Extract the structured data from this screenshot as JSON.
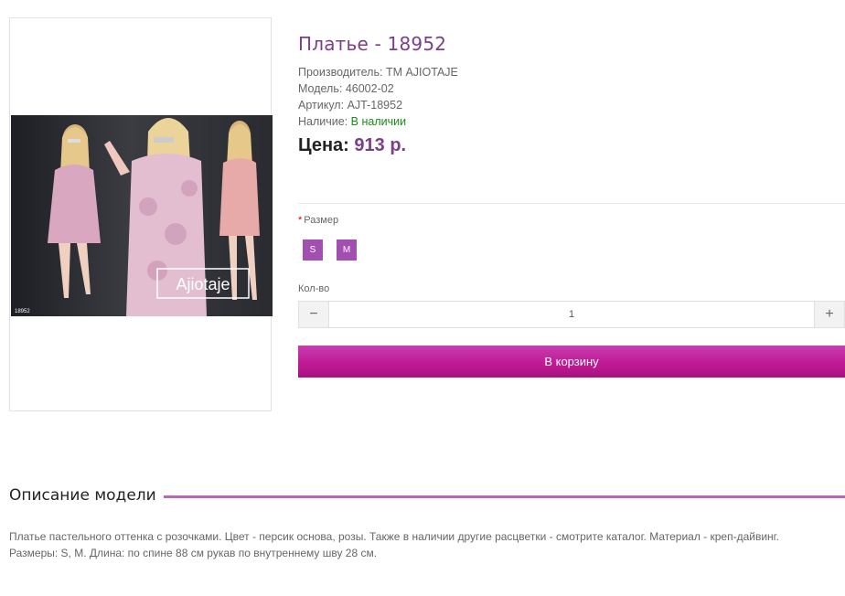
{
  "product": {
    "title": "Платье - 18952",
    "manufacturer_label": "Производитель:",
    "manufacturer": "ТМ AJIOTAJE",
    "model_label": "Модель:",
    "model": "46002-02",
    "sku_label": "Артикул:",
    "sku": "AJT-18952",
    "stock_label": "Наличие:",
    "stock": "В наличии",
    "price_label": "Цена:",
    "price": "913 р."
  },
  "image": {
    "brand": "Ajiotaje",
    "code": "18952"
  },
  "options": {
    "required_mark": "*",
    "size_label": "Размер",
    "sizes": [
      "S",
      "M"
    ]
  },
  "quantity": {
    "label": "Кол-во",
    "minus": "−",
    "value": "1",
    "plus": "+"
  },
  "cart": {
    "label": "В корзину"
  },
  "description": {
    "title": "Описание модели",
    "text": "Платье пастельного оттенка с розочками. Цвет - персик основа, розы. Также в наличии другие расцветки - смотрите каталог. Материал - креп-дайвинг. Размеры: S, M. Длина: по спине 88 см рукав по внутреннему шву 28 см."
  },
  "colors": {
    "accent": "#7b3f8a",
    "button": "#c01a95",
    "size_option": "#a34fb2",
    "in_stock": "#1a8c1a"
  }
}
